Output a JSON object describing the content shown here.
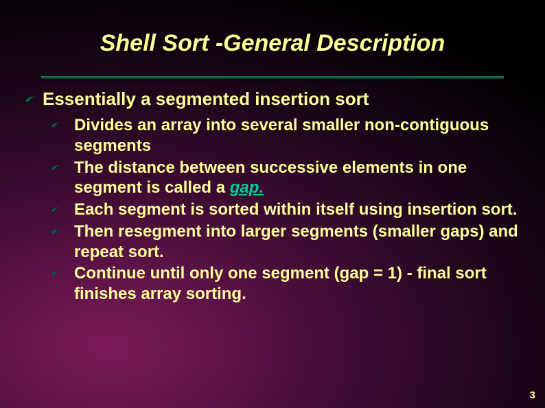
{
  "title": "Shell Sort -General Description",
  "main": {
    "heading": "Essentially a segmented insertion sort",
    "items": [
      {
        "pre": "Divides an array into several smaller non-contiguous segments",
        "em": "",
        "post": ""
      },
      {
        "pre": "The distance between successive elements in one segment is called a ",
        "em": "gap.",
        "post": ""
      },
      {
        "pre": "Each segment is sorted within itself using insertion sort.",
        "em": "",
        "post": ""
      },
      {
        "pre": "Then resegment into larger segments (smaller gaps) and repeat sort.",
        "em": "",
        "post": ""
      },
      {
        "pre": "Continue until only one segment (gap = 1) - final sort finishes array sorting.",
        "em": "",
        "post": ""
      }
    ]
  },
  "pageNumber": "3"
}
